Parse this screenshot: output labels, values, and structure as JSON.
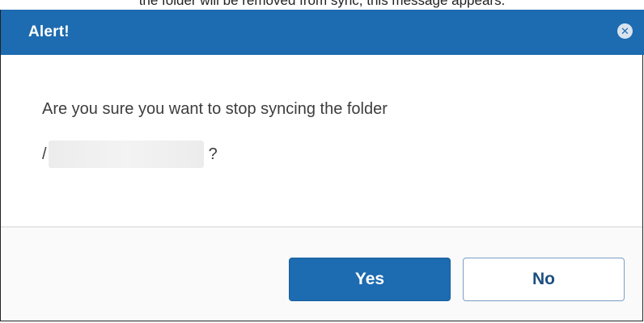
{
  "background_text": "the folder will be removed from sync, this message appears.",
  "dialog": {
    "title": "Alert!",
    "close_icon": "close-circle-icon",
    "message_line1": "Are you sure you want to stop syncing the folder",
    "path_prefix": "/",
    "path_suffix": "?",
    "buttons": {
      "yes_label": "Yes",
      "no_label": "No"
    }
  },
  "colors": {
    "titlebar": "#1d6bb0",
    "primary_button": "#1d6bb0",
    "footer_bg": "#fafafa"
  }
}
